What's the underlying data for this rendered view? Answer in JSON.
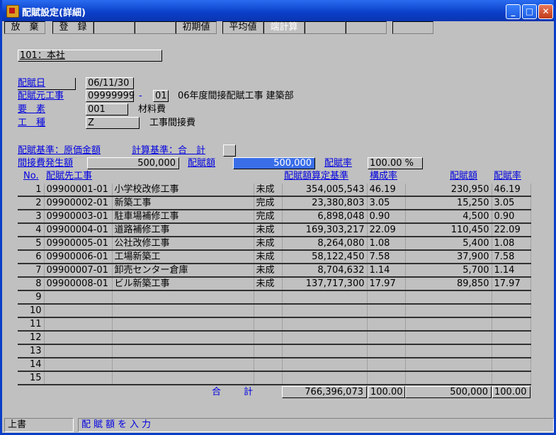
{
  "window": {
    "title": "配賦設定(詳細)",
    "min": "_",
    "max": "□",
    "close": "✕"
  },
  "fkeys": [
    "放　棄",
    "登　録",
    "",
    "",
    "初期値",
    "平均値",
    "端計算",
    "",
    "",
    ""
  ],
  "company": "101：本社",
  "fields": {
    "date_label": "配賦日",
    "date_value": "06/11/30",
    "source_label": "配賦元工事",
    "source_code": "09999999",
    "source_dash": "-",
    "source_branch": "01",
    "source_name": "06年度間接配賦工事 建築部",
    "element_label": "要　素",
    "element_code": "001",
    "element_name": "材料費",
    "type_label": "工　種",
    "type_code": "Z",
    "type_name": "工事間接費"
  },
  "basis": {
    "alloc_basis_label": "配賦基準：原価金額",
    "calc_basis_label": "計算基準：合　計",
    "incurred_label": "間接費発生額",
    "incurred_value": "500,000",
    "alloc_amount_label": "配賦額",
    "alloc_amount_value": "500,000",
    "alloc_rate_label": "配賦率",
    "alloc_rate_value": "100.00 %"
  },
  "table": {
    "headers": {
      "no": "No.",
      "dest": "配賦先工事",
      "basis": "配賦額算定基準",
      "ratio": "構成率",
      "amount": "配賦額",
      "rate": "配賦率"
    },
    "rows": [
      {
        "no": "1",
        "code": "09900001-01",
        "name": "小学校改修工事",
        "status": "未成",
        "basis": "354,005,543",
        "ratio": "46.19",
        "amount": "230,950",
        "rate": "46.19"
      },
      {
        "no": "2",
        "code": "09900002-01",
        "name": "新築工事",
        "status": "完成",
        "basis": "23,380,803",
        "ratio": "3.05",
        "amount": "15,250",
        "rate": "3.05"
      },
      {
        "no": "3",
        "code": "09900003-01",
        "name": "駐車場補修工事",
        "status": "完成",
        "basis": "6,898,048",
        "ratio": "0.90",
        "amount": "4,500",
        "rate": "0.90"
      },
      {
        "no": "4",
        "code": "09900004-01",
        "name": "道路補修工事",
        "status": "未成",
        "basis": "169,303,217",
        "ratio": "22.09",
        "amount": "110,450",
        "rate": "22.09"
      },
      {
        "no": "5",
        "code": "09900005-01",
        "name": "公社改修工事",
        "status": "未成",
        "basis": "8,264,080",
        "ratio": "1.08",
        "amount": "5,400",
        "rate": "1.08"
      },
      {
        "no": "6",
        "code": "09900006-01",
        "name": "工場新築工",
        "status": "未成",
        "basis": "58,122,450",
        "ratio": "7.58",
        "amount": "37,900",
        "rate": "7.58"
      },
      {
        "no": "7",
        "code": "09900007-01",
        "name": "卸売センター倉庫",
        "status": "未成",
        "basis": "8,704,632",
        "ratio": "1.14",
        "amount": "5,700",
        "rate": "1.14"
      },
      {
        "no": "8",
        "code": "09900008-01",
        "name": "ビル新築工事",
        "status": "未成",
        "basis": "137,717,300",
        "ratio": "17.97",
        "amount": "89,850",
        "rate": "17.97"
      },
      {
        "no": "9",
        "code": "",
        "name": "",
        "status": "",
        "basis": "",
        "ratio": "",
        "amount": "",
        "rate": ""
      },
      {
        "no": "10",
        "code": "",
        "name": "",
        "status": "",
        "basis": "",
        "ratio": "",
        "amount": "",
        "rate": ""
      },
      {
        "no": "11",
        "code": "",
        "name": "",
        "status": "",
        "basis": "",
        "ratio": "",
        "amount": "",
        "rate": ""
      },
      {
        "no": "12",
        "code": "",
        "name": "",
        "status": "",
        "basis": "",
        "ratio": "",
        "amount": "",
        "rate": ""
      },
      {
        "no": "13",
        "code": "",
        "name": "",
        "status": "",
        "basis": "",
        "ratio": "",
        "amount": "",
        "rate": ""
      },
      {
        "no": "14",
        "code": "",
        "name": "",
        "status": "",
        "basis": "",
        "ratio": "",
        "amount": "",
        "rate": ""
      },
      {
        "no": "15",
        "code": "",
        "name": "",
        "status": "",
        "basis": "",
        "ratio": "",
        "amount": "",
        "rate": ""
      }
    ],
    "total": {
      "label": "合　　計",
      "basis": "766,396,073",
      "ratio": "100.00",
      "amount": "500,000",
      "rate": "100.00"
    }
  },
  "status": {
    "mode": "上書",
    "message": "配賦額を入力"
  }
}
